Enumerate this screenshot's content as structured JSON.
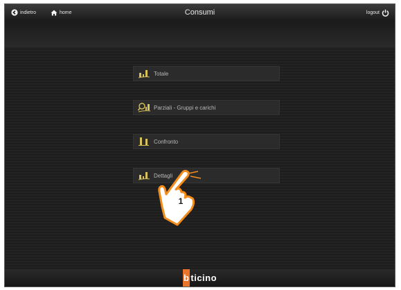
{
  "header": {
    "back_label": "indietro",
    "home_label": "home",
    "title": "Consumi",
    "logout_label": "logout"
  },
  "menu": {
    "items": [
      {
        "label": "Totale",
        "icon": "bar-chart-icon"
      },
      {
        "label": "Parziali - Gruppi e carichi",
        "icon": "magnify-chart-icon"
      },
      {
        "label": "Confronto",
        "icon": "compare-chart-icon"
      },
      {
        "label": "Dettagli",
        "icon": "bar-chart-icon"
      }
    ]
  },
  "footer": {
    "brand_first": "b",
    "brand_rest": "ticino"
  },
  "callout": {
    "step": "1",
    "icon": "pointing-hand-icon"
  },
  "colors": {
    "icon_yellow": "#d8c25a",
    "brand_orange": "#e8732a",
    "callout_orange": "#f28c1c"
  }
}
